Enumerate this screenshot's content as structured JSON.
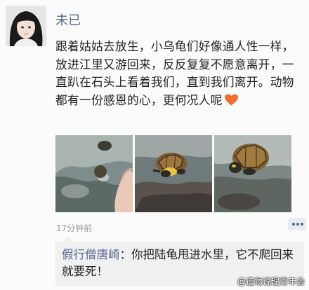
{
  "user": {
    "name": "未已"
  },
  "post": {
    "text": "跟着姑姑去放生，小乌龟们好像通人性一样，放进江里又游回来，反反复复不愿意离开，一直趴在石头上看着我们，直到我们离开。动物都有一份感恩的心，更何况人呢",
    "emoji": "heart-emoji",
    "time": "17分钟前"
  },
  "photos": [
    {
      "name": "photo-hand-turtle"
    },
    {
      "name": "photo-turtle-on-rock"
    },
    {
      "name": "photo-turtle-closeup"
    }
  ],
  "comment": {
    "author": "假行僧唐崎",
    "separator": "：",
    "text": "你把陆龟甩进水里，它不爬回来就要死！"
  },
  "watermark": {
    "text": "@造物说理青年会"
  },
  "colors": {
    "link": "#56698f",
    "heart": "#f26d2b",
    "comment_bg": "#f0f0f0"
  }
}
